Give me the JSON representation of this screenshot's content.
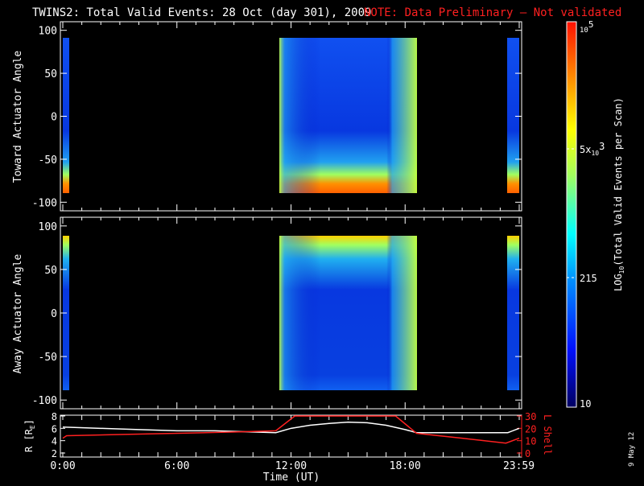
{
  "title": "TWINS2: Total Valid Events: 28 Oct (day 301), 2009",
  "note": "NOTE: Data Preliminary — Not validated",
  "date_stamp": "9 May 12",
  "colors": {
    "note": "#ff2020",
    "lshell": "#ff2020",
    "radius": "#ffffff"
  },
  "chart_data": [
    {
      "type": "heatmap",
      "panel": "toward",
      "ylabel": "Toward Actuator Angle",
      "ylim": [
        -110,
        110
      ],
      "yticks": [
        "100",
        "50",
        "0",
        "-50",
        "-100"
      ],
      "coverage_hours": [
        [
          0.0,
          0.35
        ],
        [
          11.4,
          18.6
        ],
        [
          23.5,
          24.0
        ]
      ],
      "description_of_values": "low counts (~10-200) at mid angles, high (~10^4-10^5) near -90 deg"
    },
    {
      "type": "heatmap",
      "panel": "away",
      "ylabel": "Away Actuator Angle",
      "ylim": [
        -110,
        110
      ],
      "yticks": [
        "100",
        "50",
        "0",
        "-50",
        "-100"
      ],
      "coverage_hours": [
        [
          0.0,
          0.35
        ],
        [
          11.4,
          18.6
        ],
        [
          23.5,
          24.0
        ]
      ]
    },
    {
      "type": "line",
      "panel": "orbit",
      "xlabel": "Time (UT)",
      "xticks": [
        "0:00",
        "6:00",
        "12:00",
        "18:00",
        "23:59"
      ],
      "ylabel_left": "R [R",
      "ylabel_left_sub": "E",
      "ylabel_left_end": "]",
      "ylabel_right": "L Shell",
      "yticks_left": [
        "8",
        "6",
        "4",
        "2"
      ],
      "yticks_right": [
        "30",
        "20",
        "10",
        "0"
      ],
      "ylim_left": [
        2,
        8
      ],
      "ylim_right": [
        0,
        30
      ],
      "series": [
        {
          "name": "R",
          "axis": "left",
          "x": [
            0,
            2,
            4,
            6,
            8,
            11.2,
            12,
            13,
            14,
            15,
            16,
            17,
            18,
            18.6,
            23.4,
            24
          ],
          "y": [
            6.2,
            6.0,
            5.8,
            5.6,
            5.6,
            5.3,
            6.0,
            6.5,
            6.8,
            7.0,
            6.9,
            6.5,
            5.8,
            5.3,
            5.3,
            6.0
          ]
        },
        {
          "name": "L Shell",
          "axis": "right",
          "x": [
            0,
            0.2,
            3,
            6,
            9,
            11.2,
            12.2,
            17.5,
            18.6,
            21,
            23.3,
            24
          ],
          "y": [
            12,
            14,
            15,
            16,
            17,
            18,
            30,
            30,
            16,
            12,
            8,
            12
          ]
        }
      ]
    },
    {
      "type": "colorbar",
      "label": "LOG",
      "label_sub": "10",
      "label_end": "(Total Valid Events per Scan)",
      "ticks": [
        {
          "value": 100000,
          "base": "10",
          "exp": "5",
          "pre": ""
        },
        {
          "value": 5000,
          "base": "10",
          "exp": "3",
          "pre": "5x"
        },
        {
          "value": 215,
          "text": "215"
        },
        {
          "value": 10,
          "text": "10"
        }
      ],
      "range": [
        10,
        100000
      ]
    }
  ]
}
